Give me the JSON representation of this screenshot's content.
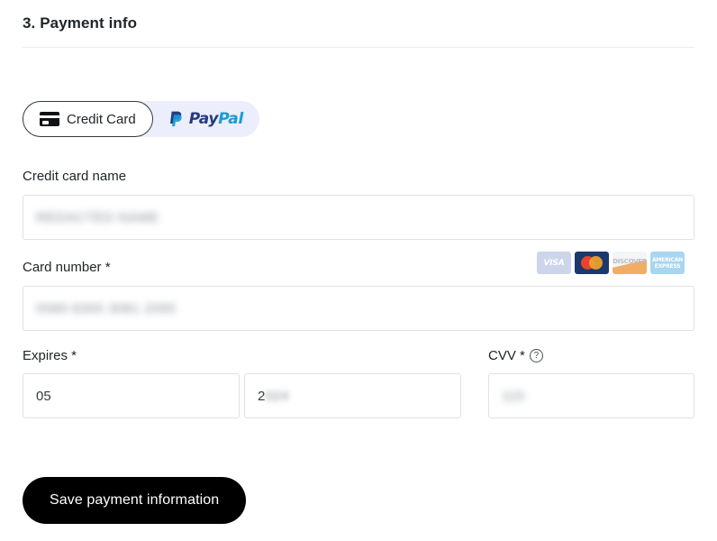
{
  "section": {
    "heading": "3. Payment info"
  },
  "payment_methods": {
    "selected": "credit-card",
    "options": [
      {
        "id": "credit-card",
        "label": "Credit Card",
        "icon": "credit-card-icon"
      },
      {
        "id": "paypal",
        "label_part1": "Pay",
        "label_part2": "Pal",
        "icon": "paypal-icon"
      }
    ]
  },
  "fields": {
    "card_name": {
      "label": "Credit card name",
      "value": "REDACTED NAME",
      "redacted": true
    },
    "card_number": {
      "label": "Card number *",
      "value": "5589 8305 3081 2095",
      "redacted": true
    },
    "expires": {
      "label": "Expires *",
      "month_value": "05",
      "year_visible_prefix": "2",
      "year_redacted_suffix": "024"
    },
    "cvv": {
      "label": "CVV *",
      "help_icon": "question-mark-icon",
      "help_glyph": "?",
      "value": "115",
      "redacted": true
    }
  },
  "accepted_cards": [
    {
      "id": "visa",
      "name": "VISA"
    },
    {
      "id": "mastercard",
      "name": "Mastercard"
    },
    {
      "id": "discover",
      "name": "DISCOVER"
    },
    {
      "id": "amex",
      "name_line1": "AMERICAN",
      "name_line2": "EXPRESS"
    }
  ],
  "actions": {
    "submit_label": "Save payment information"
  },
  "colors": {
    "submit_bg": "#000000",
    "toggle_bg": "#eceefb",
    "paypal_dark": "#253b80",
    "paypal_light": "#179bd7",
    "border": "#dee2e6"
  }
}
